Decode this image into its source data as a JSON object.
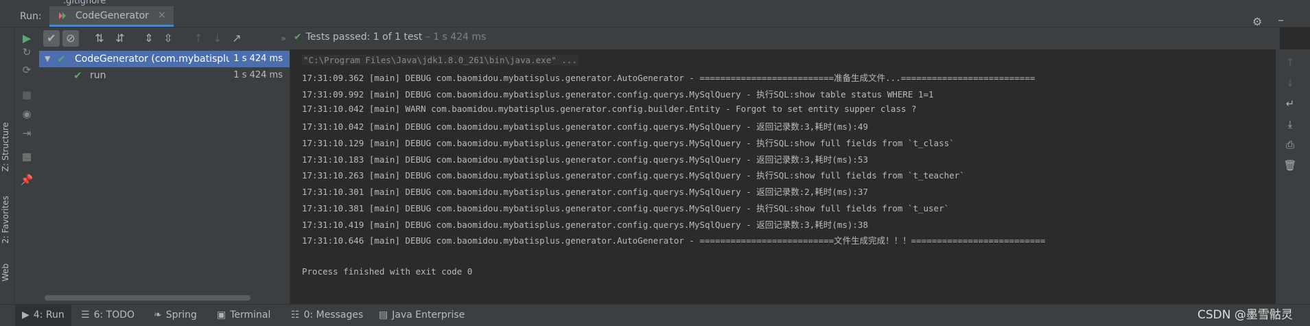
{
  "top_file": ".gitignore",
  "run_header": {
    "label": "Run:",
    "tab_label": "CodeGenerator",
    "close_glyph": "×",
    "settings_icon": "gear-icon",
    "minimize_glyph": "–"
  },
  "left_strip": {
    "tabs": [
      "Z: Structure",
      "2: Favorites",
      "Web"
    ]
  },
  "toolbar": {
    "status_prefix": "Tests passed: ",
    "status_count": "1",
    "status_suffix": " of 1 test",
    "status_time": " – 1 s 424 ms"
  },
  "tree": {
    "rows": [
      {
        "name": "CodeGenerator (com.mybatisplu",
        "duration": "1 s 424 ms"
      },
      {
        "name": "run",
        "duration": "1 s 424 ms"
      }
    ]
  },
  "console": {
    "lines": [
      "\"C:\\Program Files\\Java\\jdk1.8.0_261\\bin\\java.exe\" ...",
      "17:31:09.362 [main] DEBUG com.baomidou.mybatisplus.generator.AutoGenerator - ==========================准备生成文件...==========================",
      "17:31:09.992 [main] DEBUG com.baomidou.mybatisplus.generator.config.querys.MySqlQuery - 执行SQL:show table status WHERE 1=1",
      "17:31:10.042 [main] WARN com.baomidou.mybatisplus.generator.config.builder.Entity - Forgot to set entity supper class ?",
      "17:31:10.042 [main] DEBUG com.baomidou.mybatisplus.generator.config.querys.MySqlQuery - 返回记录数:3,耗时(ms):49",
      "17:31:10.129 [main] DEBUG com.baomidou.mybatisplus.generator.config.querys.MySqlQuery - 执行SQL:show full fields from `t_class`",
      "17:31:10.183 [main] DEBUG com.baomidou.mybatisplus.generator.config.querys.MySqlQuery - 返回记录数:3,耗时(ms):53",
      "17:31:10.263 [main] DEBUG com.baomidou.mybatisplus.generator.config.querys.MySqlQuery - 执行SQL:show full fields from `t_teacher`",
      "17:31:10.301 [main] DEBUG com.baomidou.mybatisplus.generator.config.querys.MySqlQuery - 返回记录数:2,耗时(ms):37",
      "17:31:10.381 [main] DEBUG com.baomidou.mybatisplus.generator.config.querys.MySqlQuery - 执行SQL:show full fields from `t_user`",
      "17:31:10.419 [main] DEBUG com.baomidou.mybatisplus.generator.config.querys.MySqlQuery - 返回记录数:3,耗时(ms):38",
      "17:31:10.646 [main] DEBUG com.baomidou.mybatisplus.generator.AutoGenerator - ==========================文件生成完成！！！==========================",
      "",
      "Process finished with exit code 0"
    ]
  },
  "bottom_bar": {
    "tabs": [
      {
        "label": "4: Run",
        "icon": "play-icon"
      },
      {
        "label": "6: TODO",
        "icon": "list-icon"
      },
      {
        "label": "Spring",
        "icon": "leaf-icon"
      },
      {
        "label": "Terminal",
        "icon": "terminal-icon"
      },
      {
        "label": "0: Messages",
        "icon": "messages-icon"
      },
      {
        "label": "Java Enterprise",
        "icon": "enterprise-icon"
      }
    ]
  },
  "watermark": "CSDN @墨雪骷灵",
  "colors": {
    "pass_green": "#59a869",
    "selection_blue": "#4b6eaf",
    "tab_underline": "#4a88c7"
  }
}
